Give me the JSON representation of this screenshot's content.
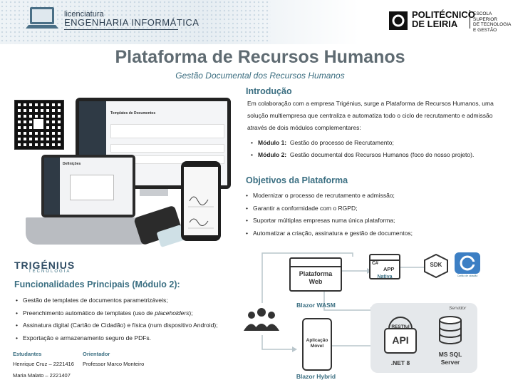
{
  "header": {
    "licenciatura_small": "licenciatura",
    "licenciatura_course": "ENGENHARIA INFORMÁTICA",
    "politecnico_line1": "POLITÉCNICO",
    "politecnico_line2": "DE LEIRIA",
    "school_line1": "ESCOLA SUPERIOR",
    "school_line2": "DE TECNOLOGIA",
    "school_line3": "E GESTÃO"
  },
  "title": "Plataforma de Recursos Humanos",
  "subtitle": "Gestão Documental dos Recursos Humanos",
  "intro": {
    "heading": "Introdução",
    "paragraph": "Em colaboração com a empresa Trigénius, surge a Plataforma de Recursos Humanos, uma solução multiempresa que centraliza e automatiza todo o ciclo de recrutamento e admissão através de dois módulos complementares:",
    "modules": [
      {
        "label": "Módulo 1:",
        "text": "Gestão do processo de Recrutamento;"
      },
      {
        "label": "Módulo 2:",
        "text": "Gestão documental dos Recursos Humanos (foco do nosso projeto)."
      }
    ]
  },
  "objectives": {
    "heading": "Objetivos da Plataforma",
    "items": [
      "Modernizar o processo de recrutamento e admissão;",
      "Garantir a conformidade com o RGPD;",
      "Suportar múltiplas empresas numa única plataforma;",
      "Automatizar a criação, assinatura e gestão de documentos;"
    ]
  },
  "trigenius": {
    "name": "TRIGÉNIUS",
    "sub": "TECNOLOGIA"
  },
  "features": {
    "heading": "Funcionalidades Principais (Módulo 2):",
    "items": [
      {
        "pre": "Gestão de templates de documentos parametrizáveis;",
        "em": "",
        "post": ""
      },
      {
        "pre": "Preenchimento automático de templates (uso de ",
        "em": "placeholders",
        "post": ");"
      },
      {
        "pre": "Assinatura digital (Cartão de Cidadão) e física (num dispositivo Android);",
        "em": "",
        "post": ""
      },
      {
        "pre": "Exportação e armazenamento seguro de PDFs.",
        "em": "",
        "post": ""
      }
    ]
  },
  "credits": {
    "students_label": "Estudantes",
    "students": [
      "Henrique Cruz – 2221416",
      "Maria Malato – 2221407"
    ],
    "advisor_label": "Orientador",
    "advisor": "Professor Marco Monteiro"
  },
  "mockup": {
    "desktop_title": "Templates de Documentos",
    "laptop_title": "Definições"
  },
  "diagram": {
    "web_line1": "Plataforma",
    "web_line2": "Web",
    "web_caption": "Blazor WASM",
    "mobile_line1": "Aplicação",
    "mobile_line2": "Móvel",
    "mobile_caption": "Blazor Hybrid",
    "app_label": "APP",
    "app_sub": "Nativa",
    "csharp": "C#",
    "sdk": "SDK",
    "cc_caption": "Cartão de cidadão",
    "server_label": "Servidor",
    "api_top": "RESTful",
    "api": "API",
    "net": ".NET 8",
    "db_line1": "MS SQL",
    "db_line2": "Server"
  },
  "colors": {
    "accent": "#3b6f82",
    "title": "#5f6b72",
    "server_bg": "#e5e8eb"
  }
}
